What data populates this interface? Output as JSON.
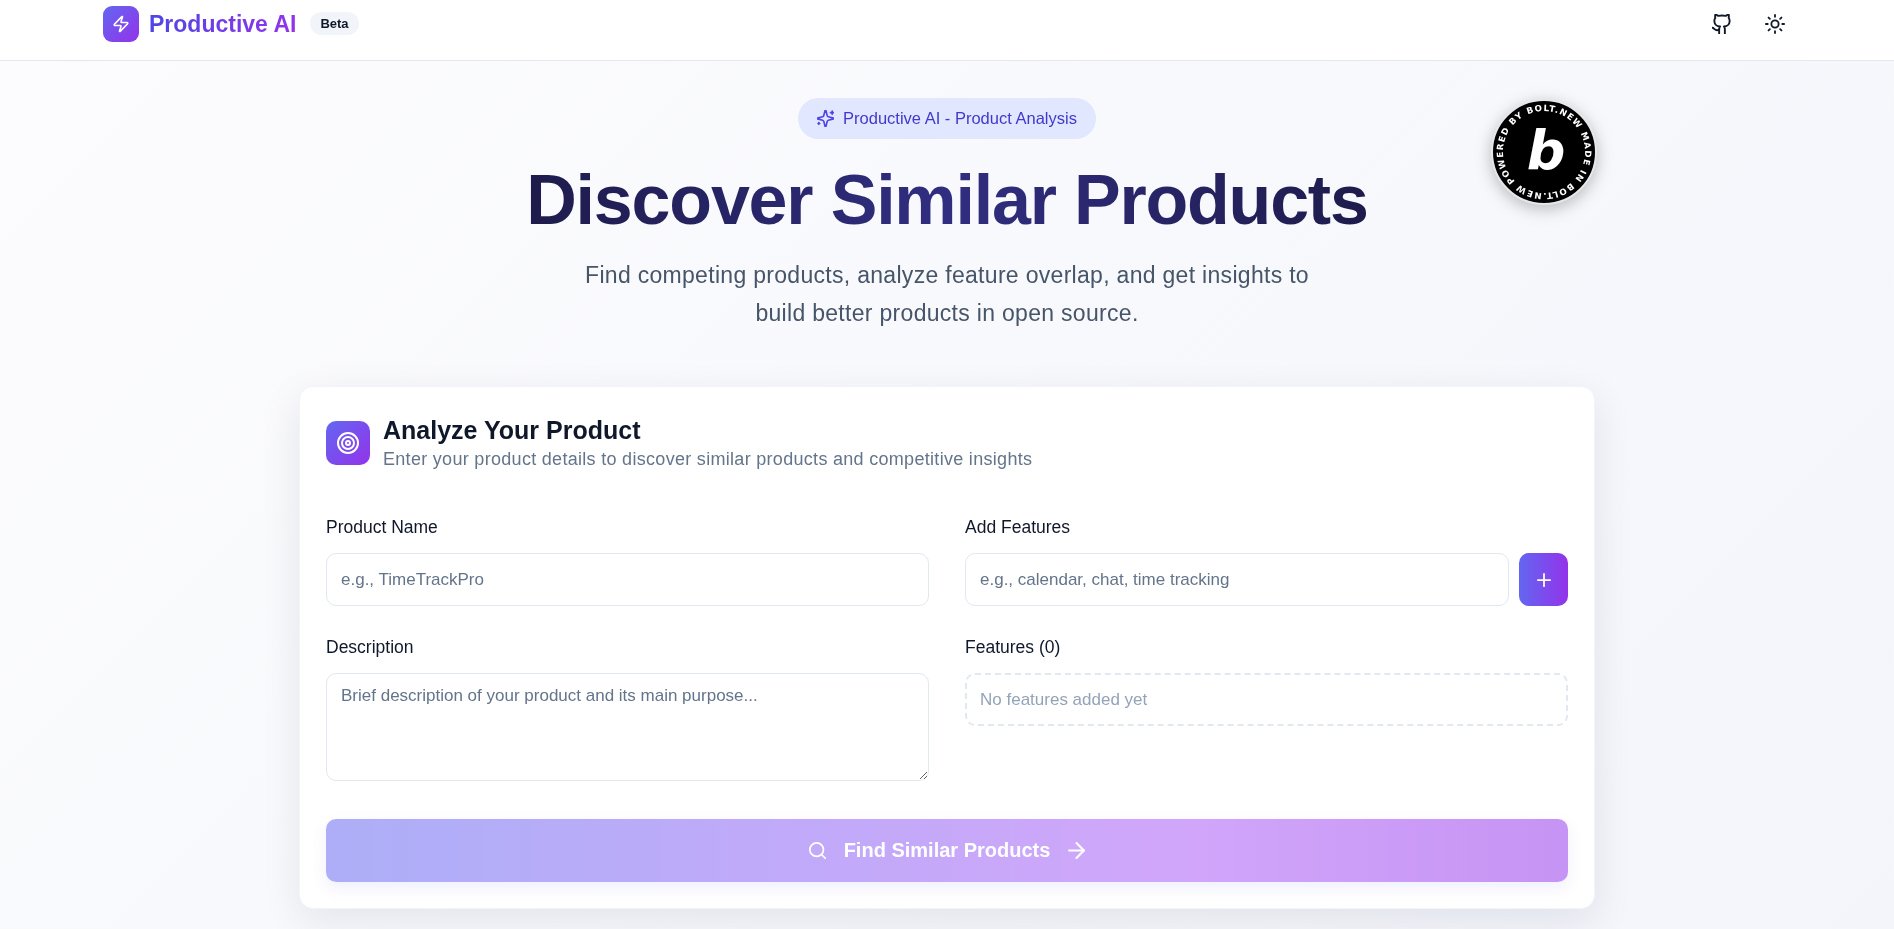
{
  "header": {
    "app_name": "Productive AI",
    "badge": "Beta"
  },
  "hero": {
    "tag": "Productive AI - Product Analysis",
    "title": "Discover Similar Products",
    "subtitle": "Find competing products, analyze feature overlap, and get insights to build better products in open source."
  },
  "form_card": {
    "title": "Analyze Your Product",
    "subtitle": "Enter your product details to discover similar products and competitive insights",
    "product_name": {
      "label": "Product Name",
      "placeholder": "e.g., TimeTrackPro"
    },
    "description": {
      "label": "Description",
      "placeholder": "Brief description of your product and its main purpose..."
    },
    "add_features": {
      "label": "Add Features",
      "placeholder": "e.g., calendar, chat, time tracking"
    },
    "features": {
      "label": "Features (0)",
      "empty_text": "No features added yet"
    },
    "submit_button": {
      "label": "Find Similar Products",
      "disabled": true
    }
  },
  "bolt_badge": {
    "ring_text": "POWERED BY BOLT.NEW MADE IN BOLT.NEW",
    "logo": "b"
  }
}
